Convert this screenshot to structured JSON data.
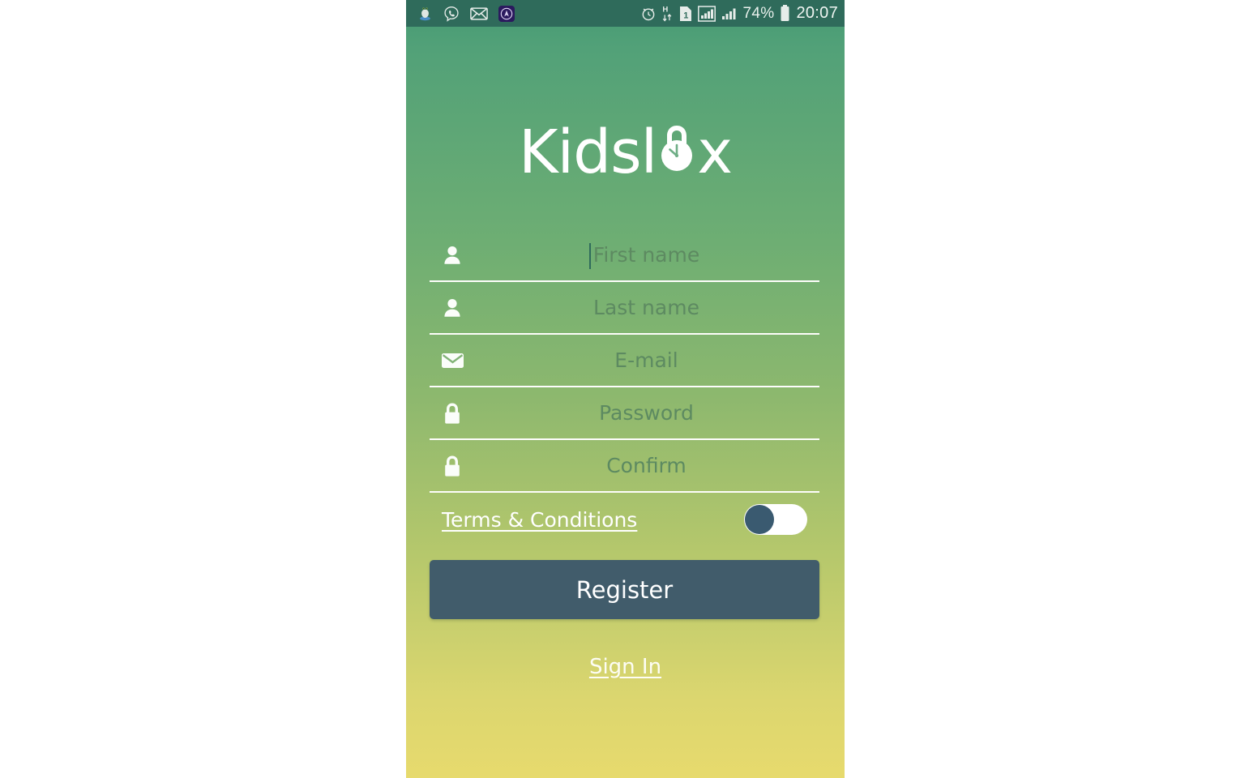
{
  "app": {
    "name": "Kidslox",
    "logo": {
      "text_before": "Kidsl",
      "lock_glyph_name": "padlock-clock-icon",
      "text_after": "x"
    },
    "brand_colors": {
      "gradient_top": "#459a74",
      "gradient_mid": "#8db86e",
      "gradient_bottom": "#e7da6d",
      "statusbar": "#2f6b5b",
      "button": "#415c6b",
      "toggle_knob": "#3a5a70",
      "placeholder_text": "#5d8a61",
      "white": "#ffffff"
    }
  },
  "statusbar": {
    "left_icons": [
      {
        "name": "bird-notification-icon",
        "glyph": "🐦"
      },
      {
        "name": "viber-icon",
        "glyph": "☎"
      },
      {
        "name": "email-notification-icon",
        "glyph": "✉"
      },
      {
        "name": "app-notification-icon",
        "glyph": "▲"
      }
    ],
    "right_icons": [
      {
        "name": "alarm-clock-icon",
        "glyph": "⏰"
      },
      {
        "name": "hspa-data-icon",
        "label": "H"
      },
      {
        "name": "sim-one-icon",
        "label": "1"
      },
      {
        "name": "signal-strength-sim1-icon",
        "label": "signal"
      },
      {
        "name": "signal-strength-sim2-icon",
        "label": "signal"
      }
    ],
    "battery_percent": "74%",
    "battery_icon": "battery-icon",
    "clock": "20:07"
  },
  "form": {
    "fields": [
      {
        "name": "first-name",
        "icon": "person-icon",
        "placeholder": "First name",
        "value": "",
        "focused": true
      },
      {
        "name": "last-name",
        "icon": "person-icon",
        "placeholder": "Last name",
        "value": "",
        "focused": false
      },
      {
        "name": "email",
        "icon": "envelope-icon",
        "placeholder": "E-mail",
        "value": "",
        "focused": false
      },
      {
        "name": "password",
        "icon": "lock-icon",
        "placeholder": "Password",
        "value": "",
        "focused": false
      },
      {
        "name": "confirm",
        "icon": "lock-icon",
        "placeholder": "Confirm",
        "value": "",
        "focused": false
      }
    ],
    "terms": {
      "label": "Terms & Conditions",
      "toggle_state": "off"
    },
    "submit_label": "Register",
    "signin_label": "Sign In"
  }
}
